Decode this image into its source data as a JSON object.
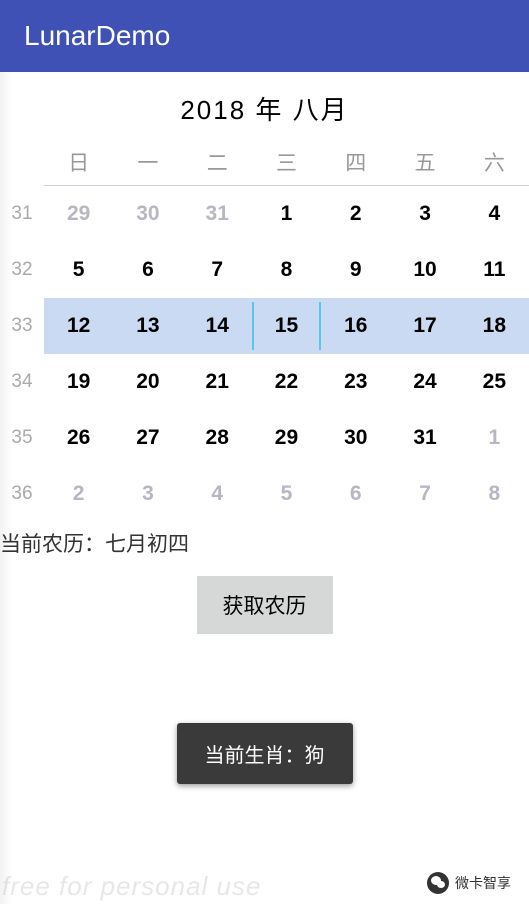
{
  "app": {
    "title": "LunarDemo"
  },
  "calendar": {
    "title": "2018 年 八月",
    "dow": [
      "日",
      "一",
      "二",
      "三",
      "四",
      "五",
      "六"
    ],
    "weeks": [
      {
        "num": "31",
        "days": [
          {
            "d": "29",
            "outside": true
          },
          {
            "d": "30",
            "outside": true
          },
          {
            "d": "31",
            "outside": true
          },
          {
            "d": "1"
          },
          {
            "d": "2"
          },
          {
            "d": "3"
          },
          {
            "d": "4"
          }
        ]
      },
      {
        "num": "32",
        "days": [
          {
            "d": "5"
          },
          {
            "d": "6"
          },
          {
            "d": "7"
          },
          {
            "d": "8"
          },
          {
            "d": "9"
          },
          {
            "d": "10"
          },
          {
            "d": "11"
          }
        ]
      },
      {
        "num": "33",
        "selected": true,
        "days": [
          {
            "d": "12"
          },
          {
            "d": "13"
          },
          {
            "d": "14"
          },
          {
            "d": "15",
            "today": true
          },
          {
            "d": "16"
          },
          {
            "d": "17"
          },
          {
            "d": "18"
          }
        ]
      },
      {
        "num": "34",
        "days": [
          {
            "d": "19"
          },
          {
            "d": "20"
          },
          {
            "d": "21"
          },
          {
            "d": "22"
          },
          {
            "d": "23"
          },
          {
            "d": "24"
          },
          {
            "d": "25"
          }
        ]
      },
      {
        "num": "35",
        "days": [
          {
            "d": "26"
          },
          {
            "d": "27"
          },
          {
            "d": "28"
          },
          {
            "d": "29"
          },
          {
            "d": "30"
          },
          {
            "d": "31"
          },
          {
            "d": "1",
            "outside": true
          }
        ]
      },
      {
        "num": "36",
        "days": [
          {
            "d": "2",
            "outside": true
          },
          {
            "d": "3",
            "outside": true
          },
          {
            "d": "4",
            "outside": true
          },
          {
            "d": "5",
            "outside": true
          },
          {
            "d": "6",
            "outside": true
          },
          {
            "d": "7",
            "outside": true
          },
          {
            "d": "8",
            "outside": true
          }
        ]
      }
    ]
  },
  "lunar_label": "当前农历：七月初四",
  "button_label": "获取农历",
  "toast": "当前生肖：狗",
  "watermark": "free for personal use",
  "brand": "微卡智享"
}
